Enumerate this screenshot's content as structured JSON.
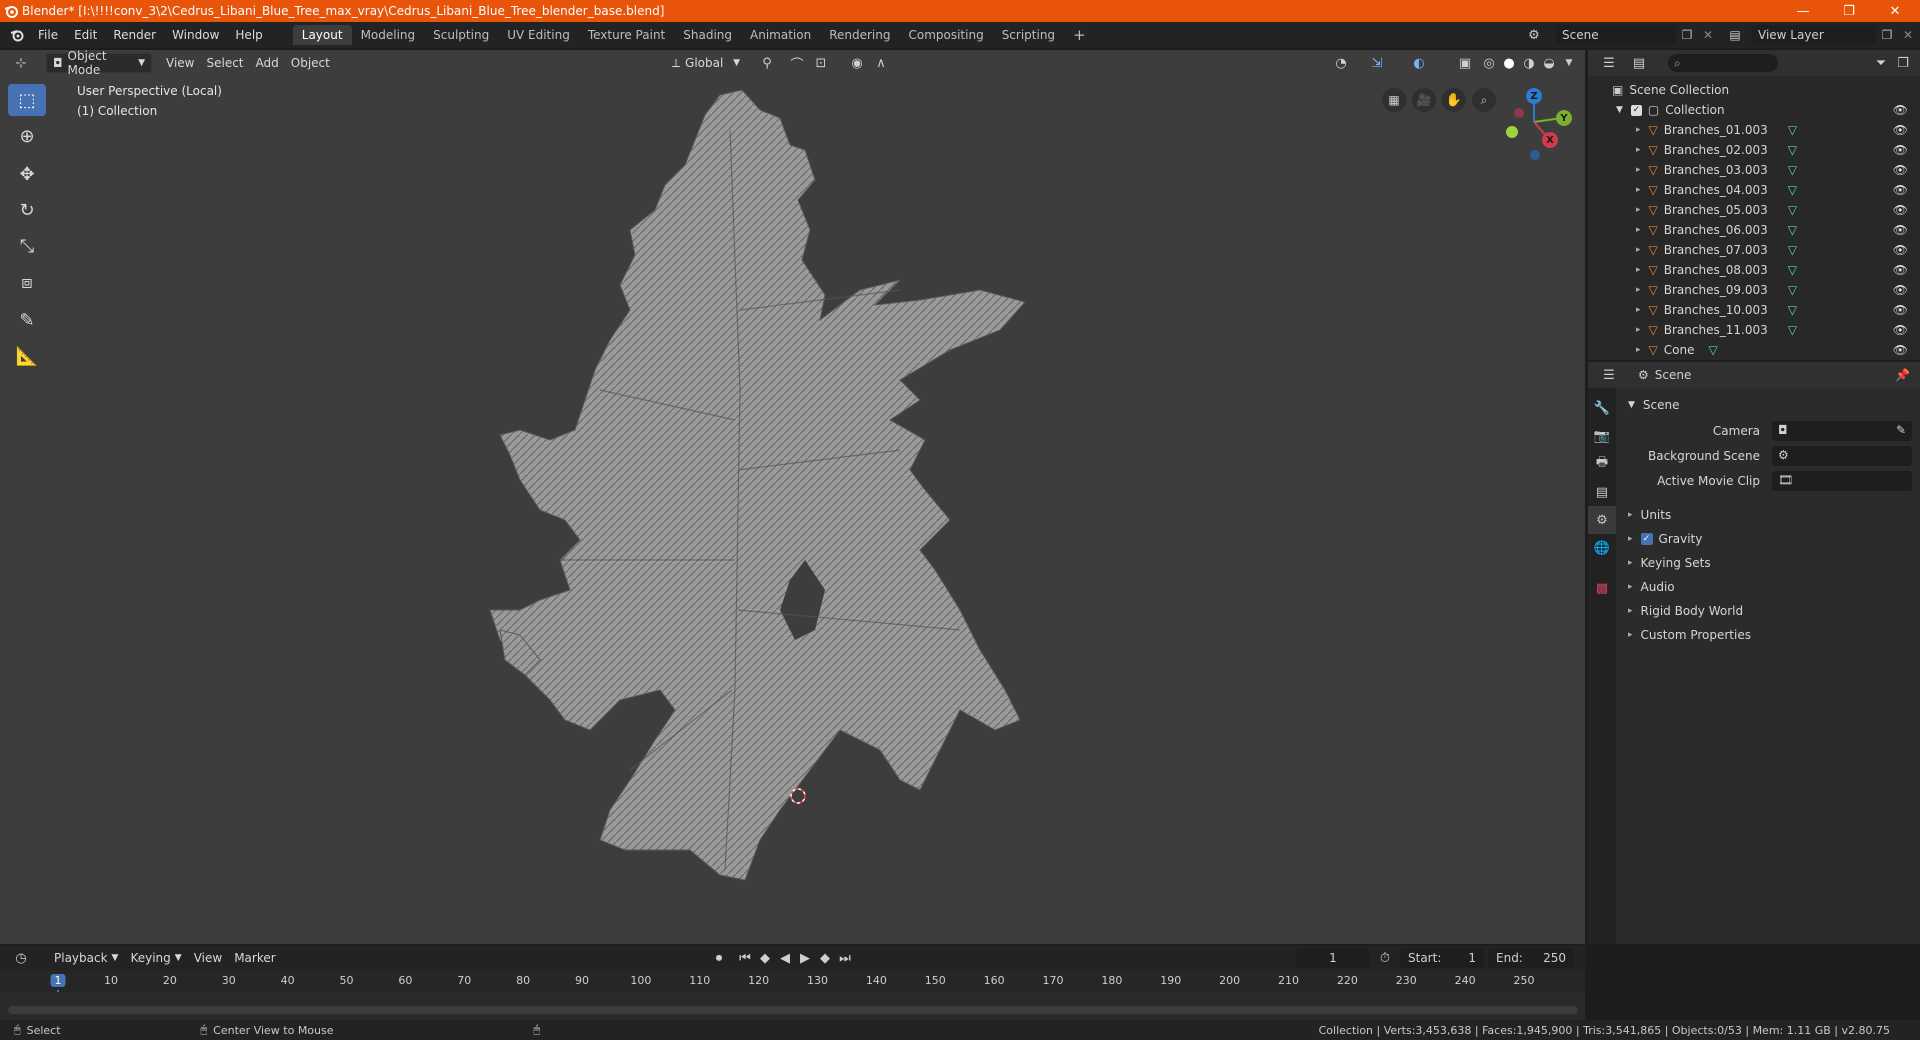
{
  "window": {
    "title": "Blender* [I:\\!!!!conv_3\\2\\Cedrus_Libani_Blue_Tree_max_vray\\Cedrus_Libani_Blue_Tree_blender_base.blend]",
    "minimize": "—",
    "maximize": "❐",
    "close": "✕"
  },
  "menu": [
    "File",
    "Edit",
    "Render",
    "Window",
    "Help"
  ],
  "workspaces": [
    "Layout",
    "Modeling",
    "Sculpting",
    "UV Editing",
    "Texture Paint",
    "Shading",
    "Animation",
    "Rendering",
    "Compositing",
    "Scripting"
  ],
  "add_workspace": "+",
  "scene_selector": {
    "label": "Scene"
  },
  "view_layer_selector": {
    "label": "View Layer"
  },
  "viewport": {
    "mode": "Object Mode",
    "menus": [
      "View",
      "Select",
      "Add",
      "Object"
    ],
    "transform_orientation": "Global",
    "overlay_line1": "User Perspective (Local)",
    "overlay_line2": "(1) Collection",
    "gizmo_axes": {
      "z": "Z",
      "y": "Y",
      "x": "X"
    }
  },
  "outliner": {
    "search_placeholder": "",
    "root": "Scene Collection",
    "collection": "Collection",
    "items": [
      "Branches_01.003",
      "Branches_02.003",
      "Branches_03.003",
      "Branches_04.003",
      "Branches_05.003",
      "Branches_06.003",
      "Branches_07.003",
      "Branches_08.003",
      "Branches_09.003",
      "Branches_10.003",
      "Branches_11.003",
      "Cone"
    ]
  },
  "properties": {
    "context": "Scene",
    "panel_title": "Scene",
    "camera_label": "Camera",
    "background_scene_label": "Background Scene",
    "active_movie_clip_label": "Active Movie Clip",
    "sections": [
      "Units",
      "Gravity",
      "Keying Sets",
      "Audio",
      "Rigid Body World",
      "Custom Properties"
    ],
    "gravity_checked": true
  },
  "timeline": {
    "menus": [
      "Playback",
      "Keying",
      "View",
      "Marker"
    ],
    "current_frame": "1",
    "start_label": "Start:",
    "start_value": "1",
    "end_label": "End:",
    "end_value": "250",
    "ruler": [
      "1",
      "10",
      "20",
      "30",
      "40",
      "50",
      "60",
      "70",
      "80",
      "90",
      "100",
      "110",
      "120",
      "130",
      "140",
      "150",
      "160",
      "170",
      "180",
      "190",
      "200",
      "210",
      "220",
      "230",
      "240",
      "250"
    ]
  },
  "statusbar": {
    "select": "Select",
    "center_view": "Center View to Mouse",
    "stats": "Collection | Verts:3,453,638 | Faces:1,945,900 | Tris:3,541,865 | Objects:0/53 | Mem: 1.11 GB | v2.80.75"
  },
  "colors": {
    "title_bar": "#e8540a",
    "accent_blue": "#4772b3",
    "mesh_orange": "#e0882f",
    "data_green": "#5fd4a0"
  }
}
